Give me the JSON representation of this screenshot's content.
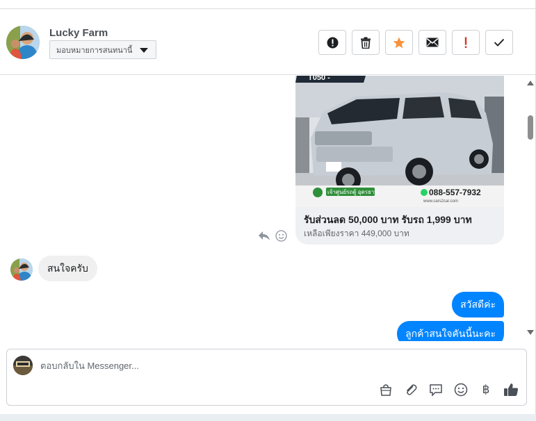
{
  "header": {
    "contact_name": "Lucky Farm",
    "assign_label": "มอบหมายการสนทนานี้",
    "toolbar": [
      {
        "icon": "alert-circle-icon"
      },
      {
        "icon": "trash-icon"
      },
      {
        "icon": "star-icon",
        "color": "#f7923a"
      },
      {
        "icon": "envelope-icon"
      },
      {
        "icon": "exclamation-icon",
        "color": "#d93025"
      },
      {
        "icon": "check-icon"
      }
    ]
  },
  "messages": {
    "product_card": {
      "title": "รับส่วนลด 50,000 บาท รับรถ 1,999 บาท",
      "subtitle": "เหลือเพียงราคา 449,000 บาท",
      "image": {
        "top_label": "T050 - ",
        "phone": "088-557-7932",
        "dealer_label": "เจ้าศูนย์รถตู้ อุดรธานี",
        "watermark": "www.cars2car.com"
      }
    },
    "incoming": "สนใจครับ",
    "outgoing": [
      "สวัสดีค่ะ",
      "ลูกค้าสนใจคันนี้นะคะ"
    ]
  },
  "composer": {
    "placeholder": "ตอบกลับใน Messenger...",
    "icons": [
      "bag-icon",
      "paperclip-icon",
      "saved-replies-icon",
      "emoji-icon",
      "baht-icon",
      "thumbs-up-icon"
    ],
    "baht_symbol": "฿"
  },
  "colors": {
    "accent_blue": "#0084ff",
    "star": "#f7923a",
    "alert_red": "#d93025"
  }
}
